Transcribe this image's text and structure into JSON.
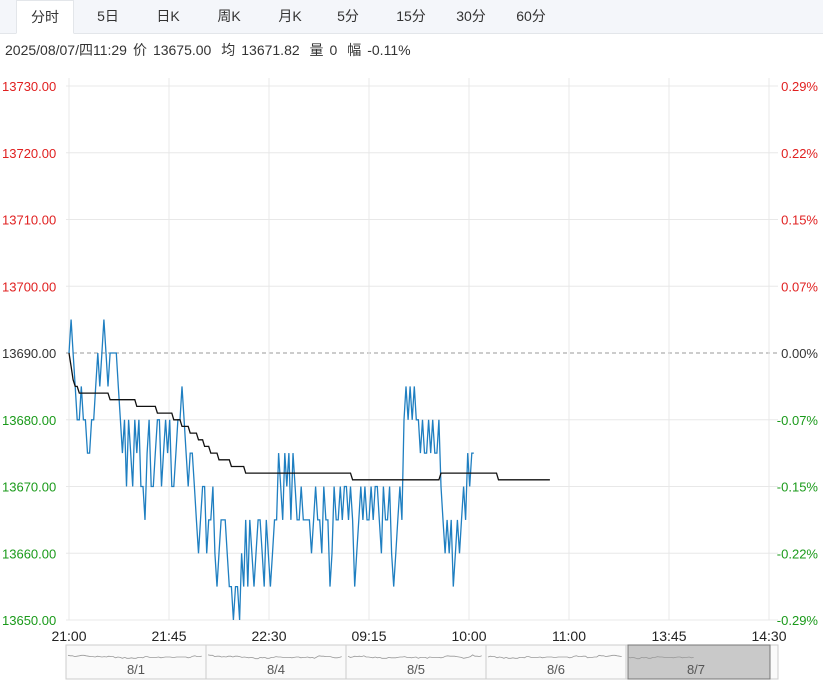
{
  "tabs": [
    {
      "label": "分时",
      "active": true
    },
    {
      "label": "5日",
      "active": false
    },
    {
      "label": "日K",
      "active": false
    },
    {
      "label": "周K",
      "active": false
    },
    {
      "label": "月K",
      "active": false
    },
    {
      "label": "5分",
      "active": false
    },
    {
      "label": "15分",
      "active": false
    },
    {
      "label": "30分",
      "active": false
    },
    {
      "label": "60分",
      "active": false
    }
  ],
  "info": {
    "datetime": "2025/08/07/四11:29",
    "price_label": "价",
    "price": "13675.00",
    "avg_label": "均",
    "avg": "13671.82",
    "volume_label": "量",
    "volume": "0",
    "range_label": "幅",
    "range": "-0.11%"
  },
  "colors": {
    "up": "#e02020",
    "down": "#1a9a1a",
    "neutral": "#333333",
    "price_line": "#1f7fc1",
    "avg_line": "#111111",
    "grid": "#e8e8e8"
  },
  "chart_data": {
    "type": "line",
    "prev_close": 13690,
    "ylim": [
      13650,
      13730
    ],
    "y_ticks_left": [
      "13730.00",
      "13720.00",
      "13710.00",
      "13700.00",
      "13690.00",
      "13680.00",
      "13670.00",
      "13660.00",
      "13650.00"
    ],
    "y_ticks_right": [
      "0.29%",
      "0.22%",
      "0.15%",
      "0.07%",
      "0.00%",
      "-0.07%",
      "-0.15%",
      "-0.22%",
      "-0.29%"
    ],
    "x_ticks": [
      "21:00",
      "21:45",
      "22:30",
      "09:15",
      "10:00",
      "11:00",
      "13:45",
      "14:30"
    ],
    "total_slots": 345,
    "series": [
      {
        "key": "price",
        "values": [
          13690,
          13695,
          13690,
          13685,
          13680,
          13680,
          13685,
          13680,
          13680,
          13675,
          13675,
          13680,
          13680,
          13685,
          13690,
          13685,
          13690,
          13695,
          13690,
          13685,
          13690,
          13690,
          13690,
          13690,
          13685,
          13680,
          13675,
          13680,
          13670,
          13680,
          13675,
          13670,
          13680,
          13675,
          13680,
          13670,
          13670,
          13665,
          13675,
          13680,
          13670,
          13670,
          13675,
          13680,
          13680,
          13670,
          13675,
          13680,
          13675,
          13680,
          13670,
          13670,
          13675,
          13680,
          13680,
          13685,
          13680,
          13675,
          13670,
          13675,
          13675,
          13670,
          13665,
          13660,
          13665,
          13670,
          13670,
          13660,
          13665,
          13665,
          13670,
          13660,
          13655,
          13660,
          13665,
          13665,
          13665,
          13660,
          13655,
          13655,
          13650,
          13655,
          13655,
          13650,
          13660,
          13655,
          13665,
          13655,
          13665,
          13660,
          13655,
          13660,
          13665,
          13665,
          13660,
          13655,
          13665,
          13660,
          13655,
          13660,
          13665,
          13665,
          13675,
          13670,
          13665,
          13675,
          13670,
          13675,
          13665,
          13675,
          13670,
          13665,
          13665,
          13670,
          13665,
          13665,
          13665,
          13665,
          13660,
          13665,
          13670,
          13665,
          13665,
          13660,
          13670,
          13665,
          13665,
          13655,
          13660,
          13670,
          13665,
          13665,
          13670,
          13665,
          13670,
          13670,
          13665,
          13670,
          13665,
          13655,
          13660,
          13665,
          13670,
          13665,
          13670,
          13665,
          13665,
          13670,
          13665,
          13670,
          13670,
          13665,
          13660,
          13670,
          13665,
          13665,
          13670,
          13660,
          13655,
          13660,
          13665,
          13670,
          13665,
          13680,
          13685,
          13680,
          13685,
          13680,
          13685,
          13680,
          13680,
          13675,
          13680,
          13675,
          13675,
          13680,
          13675,
          13680,
          13675,
          13675,
          13680,
          13670,
          13665,
          13660,
          13665,
          13660,
          13665,
          13655,
          13660,
          13665,
          13660,
          13665,
          13670,
          13665,
          13675,
          13670,
          13675,
          13675
        ],
        "color": "#1f7fc1"
      },
      {
        "key": "average",
        "values": [
          13690,
          13688,
          13686,
          13685,
          13685,
          13684,
          13684,
          13684,
          13684,
          13684,
          13684,
          13684,
          13684,
          13684,
          13684,
          13684,
          13684,
          13684,
          13684,
          13684,
          13683,
          13683,
          13683,
          13683,
          13683,
          13683,
          13683,
          13683,
          13683,
          13683,
          13683,
          13683,
          13683,
          13682,
          13682,
          13682,
          13682,
          13682,
          13682,
          13682,
          13682,
          13682,
          13682,
          13681,
          13681,
          13681,
          13681,
          13681,
          13681,
          13681,
          13681,
          13680,
          13680,
          13680,
          13680,
          13679,
          13679,
          13679,
          13679,
          13678,
          13678,
          13678,
          13678,
          13677,
          13677,
          13677,
          13676,
          13676,
          13676,
          13675,
          13675,
          13675,
          13675,
          13674,
          13674,
          13674,
          13674,
          13674,
          13674,
          13673,
          13673,
          13673,
          13673,
          13673,
          13673,
          13673,
          13672,
          13672,
          13672,
          13672,
          13672,
          13672,
          13672,
          13672,
          13672,
          13672,
          13672,
          13672,
          13672,
          13672,
          13672,
          13672,
          13672,
          13672,
          13672,
          13672,
          13672,
          13672,
          13672,
          13672,
          13672,
          13672,
          13672,
          13672,
          13672,
          13672,
          13672,
          13672,
          13672,
          13672,
          13672,
          13672,
          13672,
          13672,
          13672,
          13672,
          13672,
          13672,
          13672,
          13672,
          13672,
          13672,
          13672,
          13672,
          13672,
          13672,
          13672,
          13672,
          13671,
          13671,
          13671,
          13671,
          13671,
          13671,
          13671,
          13671,
          13671,
          13671,
          13671,
          13671,
          13671,
          13671,
          13671,
          13671,
          13671,
          13671,
          13671,
          13671,
          13671,
          13671,
          13671,
          13671,
          13671,
          13671,
          13671,
          13671,
          13671,
          13671,
          13671,
          13671,
          13671,
          13671,
          13671,
          13671,
          13671,
          13671,
          13671,
          13671,
          13671,
          13671,
          13671,
          13672,
          13672,
          13672,
          13672,
          13672,
          13672,
          13672,
          13672,
          13672,
          13672,
          13672,
          13672,
          13672,
          13672,
          13672,
          13672,
          13672,
          13672,
          13672,
          13672,
          13672,
          13672,
          13672,
          13672,
          13672,
          13672,
          13672,
          13672,
          13671,
          13671,
          13671,
          13671,
          13671,
          13671,
          13671,
          13671,
          13671,
          13671,
          13671,
          13671,
          13671,
          13671,
          13671,
          13671,
          13671,
          13671,
          13671,
          13671,
          13671,
          13671,
          13671,
          13671,
          13671,
          13671
        ],
        "color": "#111111"
      }
    ],
    "navigator": {
      "labels": [
        "8/1",
        "8/4",
        "8/5",
        "8/6",
        "8/7"
      ],
      "selected": "8/7"
    }
  }
}
